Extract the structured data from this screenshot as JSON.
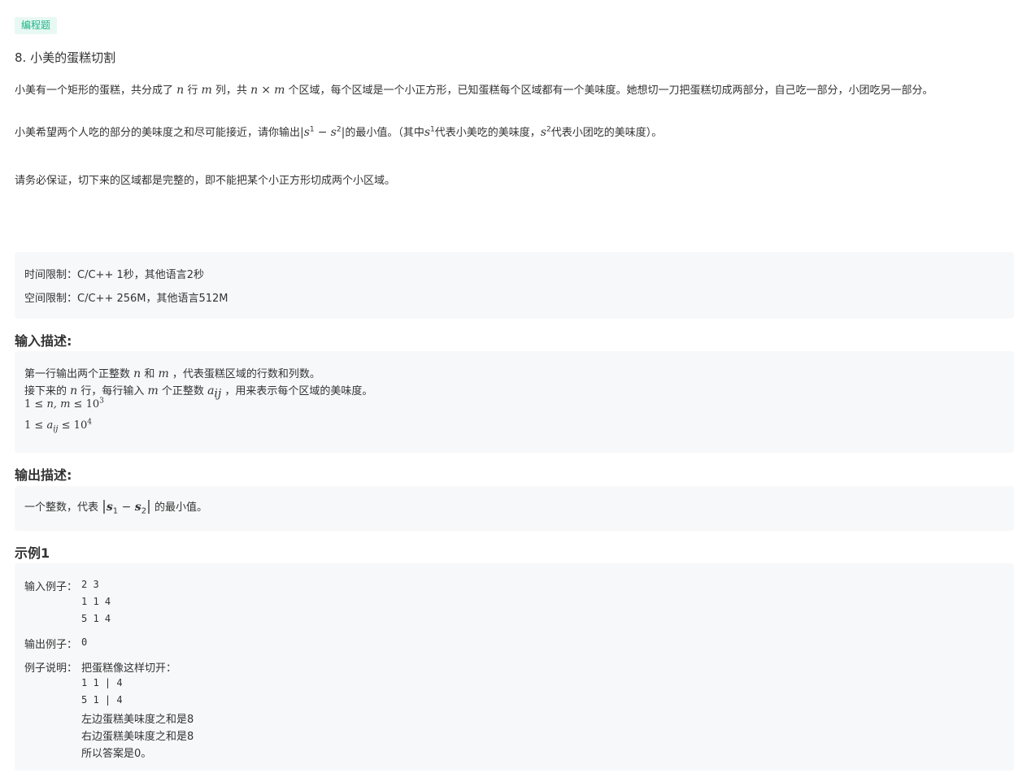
{
  "tag": "编程题",
  "title": "8. 小美的蛋糕切割",
  "desc": {
    "p1_a": "小美有一个矩形的蛋糕，共分成了",
    "p1_n": "n",
    "p1_b": "行",
    "p1_m": "m",
    "p1_c": "列，共",
    "p1_nm_n": "n",
    "p1_times": "×",
    "p1_nm_m": "m",
    "p1_d": "个区域，每个区域是一个小正方形，已知蛋糕每个区域都有一个美味度。她想切一刀把蛋糕切成两部分，自己吃一部分，小团吃另一部分。",
    "p2_a": "小美希望两个人吃的部分的美味度之和尽可能接近，请你输出",
    "p2_formula_s": "s",
    "p2_formula_sup1": "1",
    "p2_formula_minus": "−",
    "p2_formula_sup2": "2",
    "p2_b": "的最小值。（其中",
    "p2_s1": "s",
    "p2_s1_sup": "1",
    "p2_c": "代表小美吃的美味度，",
    "p2_s2": "s",
    "p2_s2_sup": "2",
    "p2_d": "代表小团吃的美味度）。",
    "p3": "请务必保证，切下来的区域都是完整的，即不能把某个小正方形切成两个小区域。"
  },
  "limits": {
    "time_label": "时间限制：",
    "time_value": "C/C++ 1秒，其他语言2秒",
    "space_label": "空间限制：",
    "space_value": "C/C++ 256M，其他语言512M"
  },
  "input_section": {
    "heading": "输入描述:",
    "l1_a": "第一行输出两个正整数",
    "l1_n": "n",
    "l1_b": "和",
    "l1_m": "m",
    "l1_c": "，代表蛋糕区域的行数和列数。",
    "l2_a": "接下来的",
    "l2_n": "n",
    "l2_b": "行，每行输入",
    "l2_m": "m",
    "l2_c": "个正整数",
    "l2_a_var": "a",
    "l2_a_sub": "ij",
    "l2_d": "，用来表示每个区域的美味度。",
    "c1_lhs": "1 ≤ ",
    "c1_vars": "n, m",
    "c1_rhs": " ≤ 10",
    "c1_exp": "3",
    "c2_lhs": "1 ≤ ",
    "c2_var": "a",
    "c2_sub": "ij",
    "c2_rhs": " ≤ 10",
    "c2_exp": "4"
  },
  "output_section": {
    "heading": "输出描述:",
    "l1_a": "一个整数，代表",
    "l1_s1": "s",
    "l1_s1_sub": "1",
    "l1_minus": " − ",
    "l1_s2": "s",
    "l1_s2_sub": "2",
    "l1_b": "的最小值。"
  },
  "example": {
    "heading": "示例1",
    "input_label": "输入例子：",
    "input_lines": [
      "2 3",
      "1 1 4",
      "5 1 4"
    ],
    "output_label": "输出例子：",
    "output_value": "0",
    "explain_label": "例子说明：",
    "explain_lines": [
      "把蛋糕像这样切开：",
      "1 1 | 4",
      "5 1 | 4",
      "左边蛋糕美味度之和是8",
      "右边蛋糕美味度之和是8",
      "所以答案是0。"
    ]
  }
}
